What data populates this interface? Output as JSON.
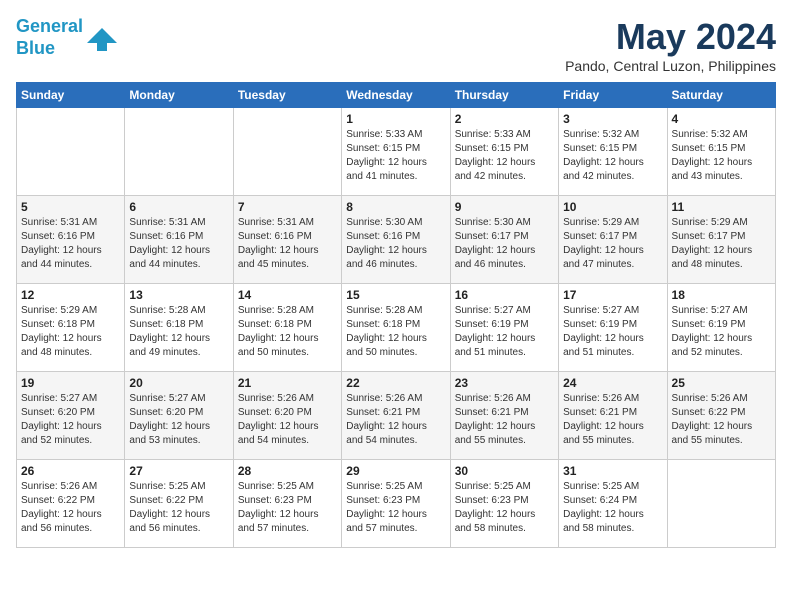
{
  "logo": {
    "line1": "General",
    "line2": "Blue"
  },
  "title": "May 2024",
  "subtitle": "Pando, Central Luzon, Philippines",
  "days_header": [
    "Sunday",
    "Monday",
    "Tuesday",
    "Wednesday",
    "Thursday",
    "Friday",
    "Saturday"
  ],
  "weeks": [
    [
      {
        "day": "",
        "info": ""
      },
      {
        "day": "",
        "info": ""
      },
      {
        "day": "",
        "info": ""
      },
      {
        "day": "1",
        "info": "Sunrise: 5:33 AM\nSunset: 6:15 PM\nDaylight: 12 hours\nand 41 minutes."
      },
      {
        "day": "2",
        "info": "Sunrise: 5:33 AM\nSunset: 6:15 PM\nDaylight: 12 hours\nand 42 minutes."
      },
      {
        "day": "3",
        "info": "Sunrise: 5:32 AM\nSunset: 6:15 PM\nDaylight: 12 hours\nand 42 minutes."
      },
      {
        "day": "4",
        "info": "Sunrise: 5:32 AM\nSunset: 6:15 PM\nDaylight: 12 hours\nand 43 minutes."
      }
    ],
    [
      {
        "day": "5",
        "info": "Sunrise: 5:31 AM\nSunset: 6:16 PM\nDaylight: 12 hours\nand 44 minutes."
      },
      {
        "day": "6",
        "info": "Sunrise: 5:31 AM\nSunset: 6:16 PM\nDaylight: 12 hours\nand 44 minutes."
      },
      {
        "day": "7",
        "info": "Sunrise: 5:31 AM\nSunset: 6:16 PM\nDaylight: 12 hours\nand 45 minutes."
      },
      {
        "day": "8",
        "info": "Sunrise: 5:30 AM\nSunset: 6:16 PM\nDaylight: 12 hours\nand 46 minutes."
      },
      {
        "day": "9",
        "info": "Sunrise: 5:30 AM\nSunset: 6:17 PM\nDaylight: 12 hours\nand 46 minutes."
      },
      {
        "day": "10",
        "info": "Sunrise: 5:29 AM\nSunset: 6:17 PM\nDaylight: 12 hours\nand 47 minutes."
      },
      {
        "day": "11",
        "info": "Sunrise: 5:29 AM\nSunset: 6:17 PM\nDaylight: 12 hours\nand 48 minutes."
      }
    ],
    [
      {
        "day": "12",
        "info": "Sunrise: 5:29 AM\nSunset: 6:18 PM\nDaylight: 12 hours\nand 48 minutes."
      },
      {
        "day": "13",
        "info": "Sunrise: 5:28 AM\nSunset: 6:18 PM\nDaylight: 12 hours\nand 49 minutes."
      },
      {
        "day": "14",
        "info": "Sunrise: 5:28 AM\nSunset: 6:18 PM\nDaylight: 12 hours\nand 50 minutes."
      },
      {
        "day": "15",
        "info": "Sunrise: 5:28 AM\nSunset: 6:18 PM\nDaylight: 12 hours\nand 50 minutes."
      },
      {
        "day": "16",
        "info": "Sunrise: 5:27 AM\nSunset: 6:19 PM\nDaylight: 12 hours\nand 51 minutes."
      },
      {
        "day": "17",
        "info": "Sunrise: 5:27 AM\nSunset: 6:19 PM\nDaylight: 12 hours\nand 51 minutes."
      },
      {
        "day": "18",
        "info": "Sunrise: 5:27 AM\nSunset: 6:19 PM\nDaylight: 12 hours\nand 52 minutes."
      }
    ],
    [
      {
        "day": "19",
        "info": "Sunrise: 5:27 AM\nSunset: 6:20 PM\nDaylight: 12 hours\nand 52 minutes."
      },
      {
        "day": "20",
        "info": "Sunrise: 5:27 AM\nSunset: 6:20 PM\nDaylight: 12 hours\nand 53 minutes."
      },
      {
        "day": "21",
        "info": "Sunrise: 5:26 AM\nSunset: 6:20 PM\nDaylight: 12 hours\nand 54 minutes."
      },
      {
        "day": "22",
        "info": "Sunrise: 5:26 AM\nSunset: 6:21 PM\nDaylight: 12 hours\nand 54 minutes."
      },
      {
        "day": "23",
        "info": "Sunrise: 5:26 AM\nSunset: 6:21 PM\nDaylight: 12 hours\nand 55 minutes."
      },
      {
        "day": "24",
        "info": "Sunrise: 5:26 AM\nSunset: 6:21 PM\nDaylight: 12 hours\nand 55 minutes."
      },
      {
        "day": "25",
        "info": "Sunrise: 5:26 AM\nSunset: 6:22 PM\nDaylight: 12 hours\nand 55 minutes."
      }
    ],
    [
      {
        "day": "26",
        "info": "Sunrise: 5:26 AM\nSunset: 6:22 PM\nDaylight: 12 hours\nand 56 minutes."
      },
      {
        "day": "27",
        "info": "Sunrise: 5:25 AM\nSunset: 6:22 PM\nDaylight: 12 hours\nand 56 minutes."
      },
      {
        "day": "28",
        "info": "Sunrise: 5:25 AM\nSunset: 6:23 PM\nDaylight: 12 hours\nand 57 minutes."
      },
      {
        "day": "29",
        "info": "Sunrise: 5:25 AM\nSunset: 6:23 PM\nDaylight: 12 hours\nand 57 minutes."
      },
      {
        "day": "30",
        "info": "Sunrise: 5:25 AM\nSunset: 6:23 PM\nDaylight: 12 hours\nand 58 minutes."
      },
      {
        "day": "31",
        "info": "Sunrise: 5:25 AM\nSunset: 6:24 PM\nDaylight: 12 hours\nand 58 minutes."
      },
      {
        "day": "",
        "info": ""
      }
    ]
  ]
}
